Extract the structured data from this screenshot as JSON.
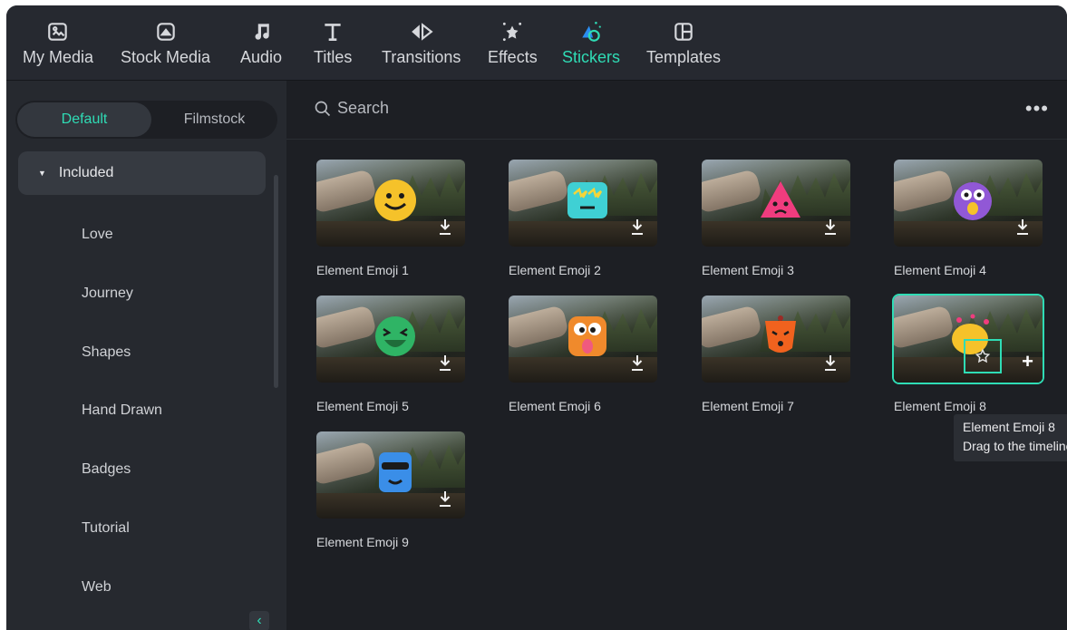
{
  "nav": {
    "tabs": [
      {
        "label": "My Media",
        "icon": "media-icon"
      },
      {
        "label": "Stock Media",
        "icon": "stock-media-icon"
      },
      {
        "label": "Audio",
        "icon": "music-note-icon"
      },
      {
        "label": "Titles",
        "icon": "text-t-icon"
      },
      {
        "label": "Transitions",
        "icon": "transitions-icon"
      },
      {
        "label": "Effects",
        "icon": "effects-star-icon"
      },
      {
        "label": "Stickers",
        "icon": "stickers-icon"
      },
      {
        "label": "Templates",
        "icon": "templates-icon"
      }
    ],
    "active": "Stickers"
  },
  "sidebar": {
    "segment": {
      "active": "Default",
      "inactive": "Filmstock"
    },
    "expanded_category": "Included",
    "categories": [
      "Love",
      "Journey",
      "Shapes",
      "Hand Drawn",
      "Badges",
      "Tutorial",
      "Web"
    ]
  },
  "search": {
    "placeholder": "Search",
    "more_label": "•••"
  },
  "stickers": [
    {
      "title": "Element Emoji 1",
      "color": "#f5c22a",
      "icon": "smiley-emoji-icon"
    },
    {
      "title": "Element Emoji 2",
      "color": "#3fd0d4",
      "icon": "star-eyes-emoji-icon"
    },
    {
      "title": "Element Emoji 3",
      "color": "#f03c7e",
      "icon": "sad-triangle-emoji-icon"
    },
    {
      "title": "Element Emoji 4",
      "color": "#9158d6",
      "icon": "shocked-emoji-icon"
    },
    {
      "title": "Element Emoji 5",
      "color": "#2fb465",
      "icon": "laughing-emoji-icon"
    },
    {
      "title": "Element Emoji 6",
      "color": "#f08a2c",
      "icon": "tongue-emoji-icon"
    },
    {
      "title": "Element Emoji 7",
      "color": "#f0621e",
      "icon": "worried-emoji-icon"
    },
    {
      "title": "Element Emoji 8",
      "color": "#f5c22a",
      "icon": "pink-dots-emoji-icon",
      "selected": true
    },
    {
      "title": "Element Emoji 9",
      "color": "#3a8ee8",
      "icon": "sunglasses-emoji-icon"
    }
  ],
  "tooltip": {
    "line1": "Element Emoji 8",
    "line2": "Drag to the timeline"
  },
  "colors": {
    "accent": "#2fdcb5",
    "background": "#1d1f24",
    "panel": "#26292f"
  }
}
